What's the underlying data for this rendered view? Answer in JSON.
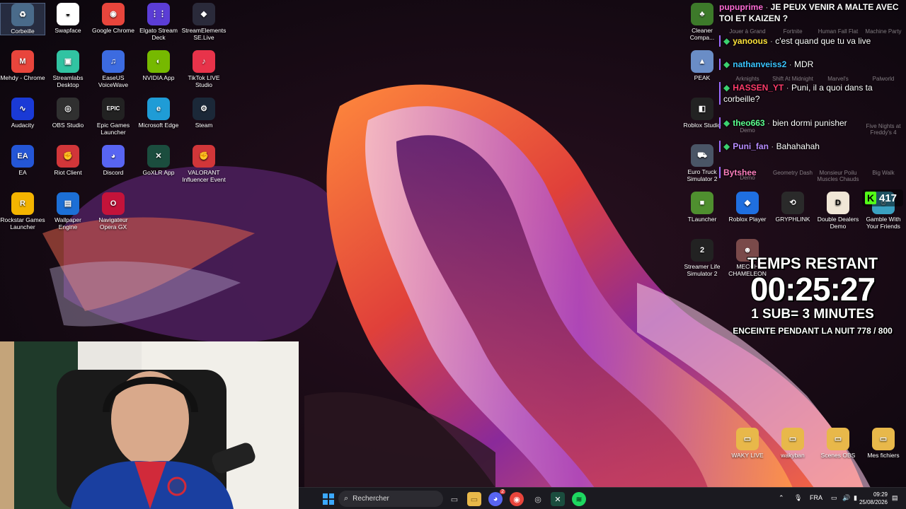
{
  "desktop_left": [
    {
      "label": "Corbeille",
      "color": "#4a6b8a",
      "glyph": "♻",
      "icon": "recycle-bin-icon"
    },
    {
      "label": "Swapface",
      "color": "#ffffff",
      "glyph": "◒",
      "icon": "mask-icon"
    },
    {
      "label": "Google Chrome",
      "color": "#e8453c",
      "glyph": "◉",
      "icon": "chrome-icon"
    },
    {
      "label": "Elgato Stream Deck",
      "color": "#5b3dd6",
      "glyph": "⋮⋮",
      "icon": "stream-deck-icon"
    },
    {
      "label": "StreamElements SE.Live",
      "color": "#2a2a3a",
      "glyph": "◆",
      "icon": "streamelements-icon"
    },
    {
      "label": "Mehdy - Chrome",
      "color": "#e8453c",
      "glyph": "M",
      "icon": "chrome-profile-icon"
    },
    {
      "label": "Streamlabs Desktop",
      "color": "#31c3a2",
      "glyph": "▣",
      "icon": "streamlabs-icon"
    },
    {
      "label": "EaseUS VoiceWave",
      "color": "#3c6be0",
      "glyph": "♫",
      "icon": "voicewave-icon"
    },
    {
      "label": "NVIDIA App",
      "color": "#76b900",
      "glyph": "◐",
      "icon": "nvidia-icon"
    },
    {
      "label": "TikTok LIVE Studio",
      "color": "#e8334a",
      "glyph": "♪",
      "icon": "tiktok-icon"
    },
    {
      "label": "Audacity",
      "color": "#1a3ad6",
      "glyph": "∿",
      "icon": "audacity-icon"
    },
    {
      "label": "OBS Studio",
      "color": "#303030",
      "glyph": "◎",
      "icon": "obs-icon"
    },
    {
      "label": "Epic Games Launcher",
      "color": "#222222",
      "glyph": "EPIC",
      "icon": "epic-games-icon"
    },
    {
      "label": "Microsoft Edge",
      "color": "#1f9cd6",
      "glyph": "e",
      "icon": "edge-icon"
    },
    {
      "label": "Steam",
      "color": "#1b2838",
      "glyph": "⚙",
      "icon": "steam-icon"
    },
    {
      "label": "EA",
      "color": "#2456d6",
      "glyph": "EA",
      "icon": "ea-icon"
    },
    {
      "label": "Riot Client",
      "color": "#d13639",
      "glyph": "✊",
      "icon": "riot-icon"
    },
    {
      "label": "Discord",
      "color": "#5865f2",
      "glyph": "◕",
      "icon": "discord-icon"
    },
    {
      "label": "GoXLR App",
      "color": "#1b4d3e",
      "glyph": "✕",
      "icon": "goxlr-icon"
    },
    {
      "label": "VALORANT Influencer Event",
      "color": "#d13639",
      "glyph": "✊",
      "icon": "valorant-icon"
    },
    {
      "label": "Rockstar Games Launcher",
      "color": "#f4b400",
      "glyph": "R",
      "icon": "rockstar-icon"
    },
    {
      "label": "Wallpaper Engine",
      "color": "#1c6fd6",
      "glyph": "▤",
      "icon": "wallpaper-engine-icon"
    },
    {
      "label": "Navigateur Opera GX",
      "color": "#c4133a",
      "glyph": "O",
      "icon": "opera-gx-icon"
    }
  ],
  "desktop_right": [
    {
      "label": "Cleaner Compa...",
      "color": "#3d7a2a",
      "glyph": "♣",
      "icon": "cleaner-icon"
    },
    {
      "label": "PEAK",
      "color": "#6a8dc6",
      "glyph": "▲",
      "icon": "peak-icon"
    },
    {
      "label": "Roblox Studio",
      "color": "#222222",
      "glyph": "◧",
      "icon": "roblox-studio-icon"
    },
    {
      "label": "Euro Truck Simulator 2",
      "color": "#4a5566",
      "glyph": "⛟",
      "icon": "truck-icon"
    },
    {
      "label": "TLauncher",
      "color": "#4f8f2f",
      "glyph": "■",
      "icon": "tlauncher-icon"
    },
    {
      "label": "Roblox Player",
      "color": "#1f6fe0",
      "glyph": "◆",
      "icon": "roblox-icon"
    },
    {
      "label": "GRYPHLINK",
      "color": "#2a2a2a",
      "glyph": "⟲",
      "icon": "gryphlink-icon"
    },
    {
      "label": "Double Dealers Demo",
      "color": "#f0e6d6",
      "glyph": "D",
      "icon": "double-dealers-icon"
    },
    {
      "label": "Gamble With Your Friends",
      "color": "#3aa0c0",
      "glyph": "☺",
      "icon": "gamble-icon"
    },
    {
      "label": "Streamer Life Simulator 2",
      "color": "#222222",
      "glyph": "2",
      "icon": "streamer-life-icon"
    },
    {
      "label": "MECCH CHAMELEON",
      "color": "#7a4a4a",
      "glyph": "☻",
      "icon": "chameleon-icon"
    },
    {
      "label": "WAKY LIVE",
      "color": "#e8b84a",
      "glyph": "▭",
      "icon": "folder-icon"
    },
    {
      "label": "wakyban",
      "color": "#e8b84a",
      "glyph": "▭",
      "icon": "folder-icon"
    },
    {
      "label": "Scenes OBS",
      "color": "#e8b84a",
      "glyph": "▭",
      "icon": "folder-icon"
    },
    {
      "label": "Mes fichiers",
      "color": "#e8b84a",
      "glyph": "▭",
      "icon": "folder-icon"
    }
  ],
  "faded_labels": [
    "Jouer à Grand",
    "Fortnite",
    "Human Fall Flat",
    "Machine Party",
    "Arknights",
    "Shift At Midnight",
    "Marvel's",
    "Palworld",
    "Demo",
    "Five Nights at Freddy's 4",
    "Demo",
    "Geometry Dash",
    "Monsieur Poilu Muscles Chauds",
    "Big Walk"
  ],
  "chat": [
    {
      "user": "pupuprime",
      "color": "#ff6bd6",
      "text": "JE PEUX VENIR A MALTE AVEC TOI ET KAIZEN ?",
      "diamond": false
    },
    {
      "user": "yanoous",
      "color": "#ffe23b",
      "text": "c'est quand que tu va live",
      "diamond": true
    },
    {
      "user": "nathanveiss2",
      "color": "#3bc4ff",
      "text": "MDR",
      "diamond": true
    },
    {
      "user": "HASSEN_YT",
      "color": "#ff3b6b",
      "text": "Puni, il a quoi dans ta corbeille?",
      "diamond": true
    },
    {
      "user": "theo663",
      "color": "#5cff8f",
      "text": "bien dormi punisher",
      "diamond": true
    },
    {
      "user": "Puni_fan",
      "color": "#b88bff",
      "text": "Bahahahah",
      "diamond": true
    },
    {
      "user": "Bytshee",
      "color": "#ff7fbf",
      "text": "",
      "diamond": false
    }
  ],
  "viewer_badge": {
    "letter": "K",
    "count": "417"
  },
  "overlay": {
    "title": "TEMPS RESTANT",
    "timer": "00:25:27",
    "sub_rule": "1 SUB= 3 MINUTES",
    "goal": "ENCEINTE PENDANT LA NUIT 778 / 800"
  },
  "taskbar": {
    "search_placeholder": "Rechercher",
    "lang": "FRA",
    "time": "09:29",
    "date": "25/08/2026",
    "discord_badge": "2"
  }
}
